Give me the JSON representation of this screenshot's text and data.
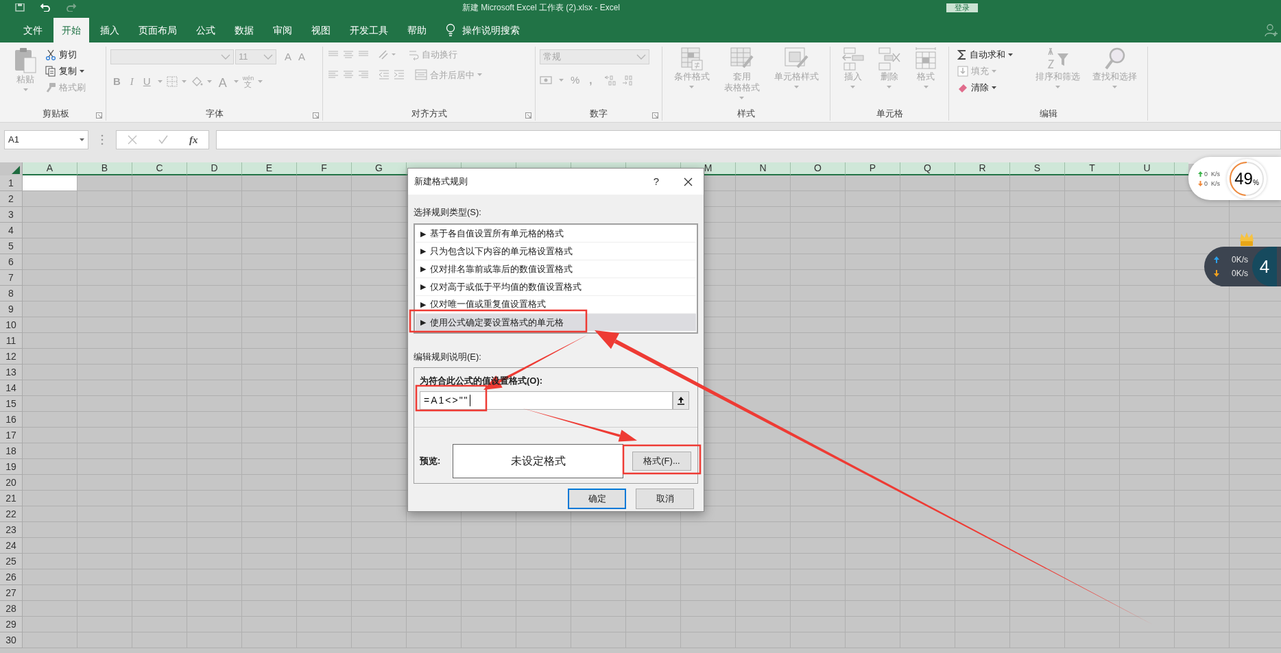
{
  "title_bar": {
    "title": "新建 Microsoft Excel 工作表 (2).xlsx  -  Excel",
    "login": "登录"
  },
  "tabs": [
    {
      "label": "文件",
      "selected": false
    },
    {
      "label": "开始",
      "selected": true
    },
    {
      "label": "插入",
      "selected": false
    },
    {
      "label": "页面布局",
      "selected": false
    },
    {
      "label": "公式",
      "selected": false
    },
    {
      "label": "数据",
      "selected": false
    },
    {
      "label": "审阅",
      "selected": false
    },
    {
      "label": "视图",
      "selected": false
    },
    {
      "label": "开发工具",
      "selected": false
    },
    {
      "label": "帮助",
      "selected": false
    }
  ],
  "tell_me": "操作说明搜索",
  "ribbon": [
    {
      "kind": "clipboard",
      "label": "剪贴板",
      "items": [
        {
          "kind": "large",
          "label": "粘贴",
          "disabled": true
        },
        {
          "kind": "small",
          "label": "剪切",
          "disabled": false,
          "dropdown": false
        },
        {
          "kind": "small",
          "label": "复制",
          "disabled": false,
          "dropdown": true
        },
        {
          "kind": "small",
          "label": "格式刷",
          "disabled": true,
          "dropdown": false
        }
      ]
    },
    {
      "kind": "font",
      "label": "字体",
      "disabled": true,
      "size": "11",
      "grow": "A",
      "shrink": "A",
      "bold": "B",
      "italic": "I",
      "underline": "U",
      "color_letter": "A",
      "phonetic_top": "wén",
      "phonetic": "文"
    },
    {
      "kind": "alignment",
      "label": "对齐方式",
      "disabled": true,
      "wrap": "自动换行",
      "merge": "合并后居中"
    },
    {
      "kind": "number",
      "label": "数字",
      "disabled": true,
      "format": "常规",
      "percent": "%",
      "comma": ","
    },
    {
      "kind": "styles",
      "label": "样式",
      "items": [
        {
          "kind": "one_line",
          "label": "条件格式",
          "disabled": true
        },
        {
          "kind": "two_line",
          "label": "套用表格格式",
          "disabled": true
        },
        {
          "kind": "one_line",
          "label": "单元格样式",
          "disabled": true
        }
      ]
    },
    {
      "kind": "cells",
      "label": "单元格",
      "items": [
        {
          "kind": "one_line",
          "label": "插入",
          "disabled": true
        },
        {
          "kind": "one_line",
          "label": "删除",
          "disabled": true
        },
        {
          "kind": "one_line",
          "label": "格式",
          "disabled": true
        }
      ]
    },
    {
      "kind": "editing",
      "label": "编辑",
      "small": [
        {
          "label": "自动求和",
          "disabled": false,
          "dropdown": true
        },
        {
          "label": "填充",
          "disabled": true,
          "dropdown": true
        },
        {
          "label": "清除",
          "disabled": false,
          "dropdown": true
        }
      ],
      "items": [
        {
          "kind": "one_line",
          "label": "排序和筛选",
          "disabled": true
        },
        {
          "kind": "one_line",
          "label": "查找和选择",
          "disabled": true
        }
      ]
    }
  ],
  "formula_bar": {
    "name_box": "A1",
    "function_label": "fx"
  },
  "sheet": {
    "columns_left": [
      "A",
      "B",
      "C",
      "D",
      "E",
      "F",
      "G"
    ],
    "columns_right": [
      "M",
      "N",
      "O",
      "P",
      "Q",
      "R",
      "S",
      "T",
      "U"
    ],
    "rows": [
      "1",
      "2",
      "3",
      "4",
      "5",
      "6",
      "7",
      "8",
      "9",
      "10",
      "11",
      "12",
      "13",
      "14",
      "15",
      "16",
      "17",
      "18",
      "19",
      "20",
      "21",
      "22",
      "23",
      "24",
      "25",
      "26",
      "27",
      "28",
      "29",
      "30"
    ]
  },
  "dialog": {
    "title": "新建格式规则",
    "help": "?",
    "rule_type_label": "选择规则类型(S):",
    "rule_types": [
      {
        "marker": "▶",
        "label": "基于各自值设置所有单元格的格式",
        "selected": false
      },
      {
        "marker": "▶",
        "label": "只为包含以下内容的单元格设置格式",
        "selected": false
      },
      {
        "marker": "▶",
        "label": "仅对排名靠前或靠后的数值设置格式",
        "selected": false
      },
      {
        "marker": "▶",
        "label": "仅对高于或低于平均值的数值设置格式",
        "selected": false
      },
      {
        "marker": "▶",
        "label": "仅对唯一值或重复值设置格式",
        "selected": false
      },
      {
        "marker": "▶",
        "label": "使用公式确定要设置格式的单元格",
        "selected": true
      }
    ],
    "description_label": "编辑规则说明(E):",
    "formula_label": "为符合此公式的值设置格式(O):",
    "formula": "=A1<>\"\"",
    "preview_label": "预览:",
    "preview_text": "未设定格式",
    "format_button": "格式(F)...",
    "ok": "确定",
    "cancel": "取消"
  },
  "speed_widget": {
    "upload": "0  K/s",
    "download": "0  K/s",
    "percent": "49",
    "percent_sign": "%",
    "level": 0.49
  },
  "accelerator_widget": {
    "upload": "0K/s",
    "download": "0K/s",
    "number": "4"
  }
}
